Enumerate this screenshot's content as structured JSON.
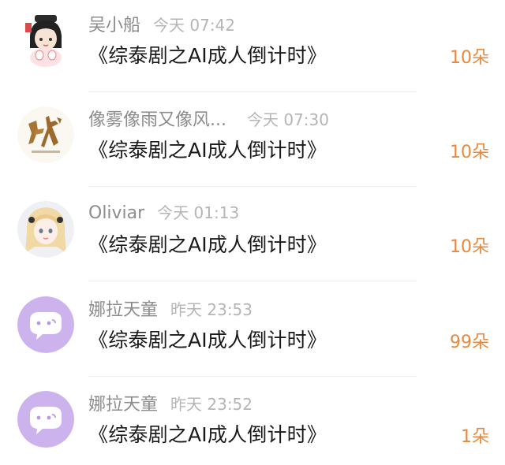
{
  "items": [
    {
      "name": "吴小船",
      "time": "今天 07:42",
      "title": "《综泰剧之AI成人倒计时》",
      "count": "10朵",
      "avatar_icon": "anime-girl-avatar-icon"
    },
    {
      "name": "像雾像雨又像风...",
      "time": "今天 07:30",
      "title": "《综泰剧之AI成人倒计时》",
      "count": "10朵",
      "avatar_icon": "calligraphy-zhan-avatar-icon"
    },
    {
      "name": "Oliviar",
      "time": "今天 01:13",
      "title": "《综泰剧之AI成人倒计时》",
      "count": "10朵",
      "avatar_icon": "blonde-girl-avatar-icon"
    },
    {
      "name": "娜拉天童",
      "time": "昨天 23:53",
      "title": "《综泰剧之AI成人倒计时》",
      "count": "99朵",
      "avatar_icon": "default-chat-avatar-icon"
    },
    {
      "name": "娜拉天童",
      "time": "昨天 23:52",
      "title": "《综泰剧之AI成人倒计时》",
      "count": "1朵",
      "avatar_icon": "default-chat-avatar-icon"
    }
  ],
  "colors": {
    "accent_count": "#e7893d",
    "default_avatar_bg": "#cdb3ee"
  }
}
